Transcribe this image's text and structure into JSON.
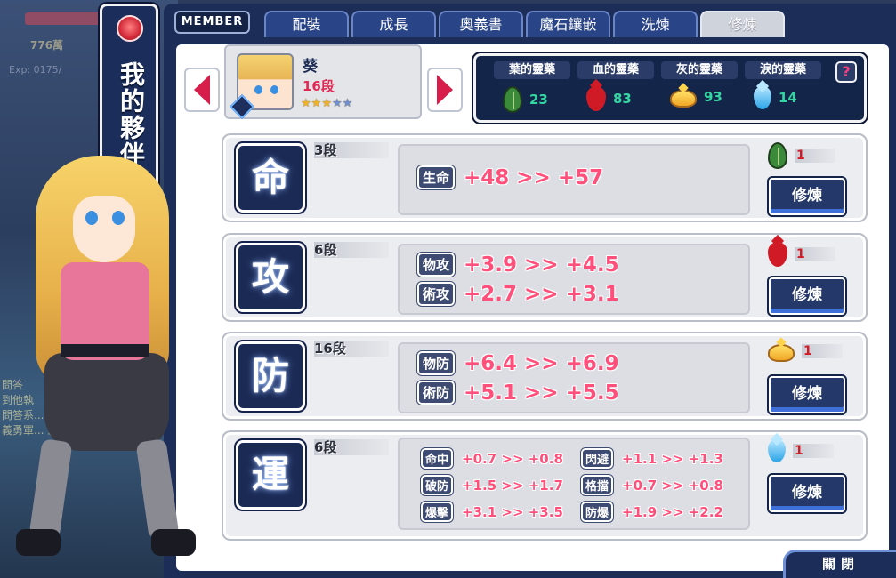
{
  "background": {
    "gold_text": "776萬",
    "exp_text": "Exp: 0175/",
    "chat_lines": [
      "問答",
      "到他執",
      "問答系... 已經",
      "義勇軍... 影日影大"
    ]
  },
  "side_title": "我的夥伴",
  "header": {
    "member_label": "MEMBER",
    "tabs": [
      {
        "label": "配裝",
        "active": false
      },
      {
        "label": "成長",
        "active": false
      },
      {
        "label": "奧義書",
        "active": false
      },
      {
        "label": "魔石鑲嵌",
        "active": false
      },
      {
        "label": "洗煉",
        "active": false
      },
      {
        "label": "修煉",
        "active": true
      }
    ]
  },
  "member": {
    "name": "葵",
    "level": "16段",
    "stars_filled": 3,
    "stars_total": 5
  },
  "resources": {
    "help_label": "?",
    "items": [
      {
        "label": "葉的靈藥",
        "count": "23",
        "icon": "leaf-potion-icon",
        "color": "#3b8a3a"
      },
      {
        "label": "血的靈藥",
        "count": "83",
        "icon": "blood-potion-icon",
        "color": "#d01b26"
      },
      {
        "label": "灰的靈藥",
        "count": "93",
        "icon": "ash-potion-icon",
        "color": "#f0a626"
      },
      {
        "label": "淚的靈藥",
        "count": "14",
        "icon": "tear-potion-icon",
        "color": "#2aa3e8"
      }
    ]
  },
  "training": [
    {
      "kanji": "命",
      "dan": "3段",
      "cost": "1",
      "cost_icon": "leaf-potion-icon",
      "button_label": "修煉",
      "stats": [
        {
          "name": "生命",
          "value": "+48 >> +57"
        }
      ]
    },
    {
      "kanji": "攻",
      "dan": "6段",
      "cost": "1",
      "cost_icon": "blood-potion-icon",
      "button_label": "修煉",
      "stats": [
        {
          "name": "物攻",
          "value": "+3.9 >> +4.5"
        },
        {
          "name": "術攻",
          "value": "+2.7 >> +3.1"
        }
      ]
    },
    {
      "kanji": "防",
      "dan": "16段",
      "cost": "1",
      "cost_icon": "ash-potion-icon",
      "button_label": "修煉",
      "stats": [
        {
          "name": "物防",
          "value": "+6.4 >> +6.9"
        },
        {
          "name": "術防",
          "value": "+5.1 >> +5.5"
        }
      ]
    },
    {
      "kanji": "運",
      "dan": "6段",
      "cost": "1",
      "cost_icon": "tear-potion-icon",
      "button_label": "修煉",
      "stats": [
        {
          "name": "命中",
          "value": "+0.7 >> +0.8"
        },
        {
          "name": "閃避",
          "value": "+1.1 >> +1.3"
        },
        {
          "name": "破防",
          "value": "+1.5 >> +1.7"
        },
        {
          "name": "格擋",
          "value": "+0.7 >> +0.8"
        },
        {
          "name": "爆擊",
          "value": "+3.1 >> +3.5"
        },
        {
          "name": "防爆",
          "value": "+1.9 >> +2.2"
        }
      ]
    }
  ],
  "close_label": "關閉"
}
